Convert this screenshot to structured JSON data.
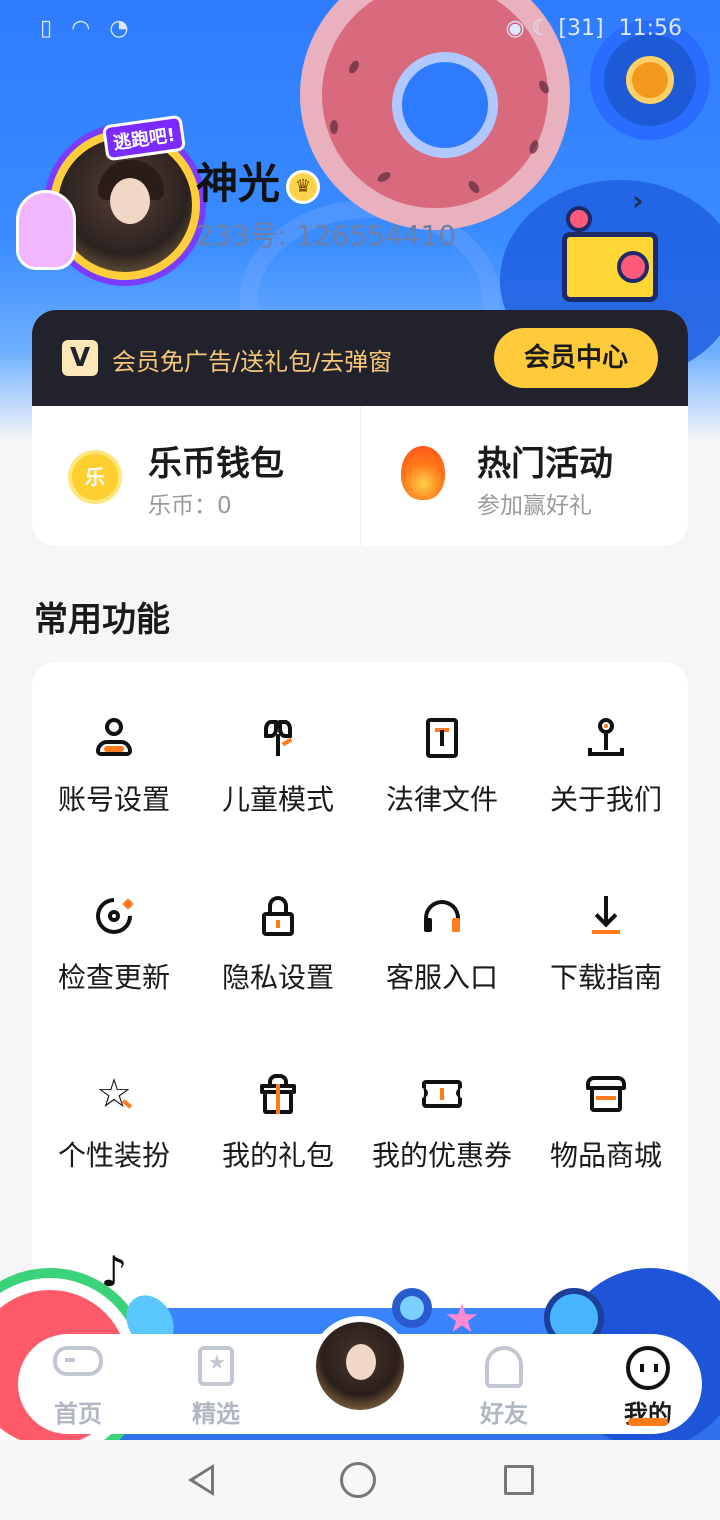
{
  "status_bar": {
    "left_icons": [
      "sim-alert-icon",
      "wifi-icon",
      "data-icon"
    ],
    "battery": "31",
    "time": "11:56"
  },
  "profile": {
    "username": "神光",
    "user_id": "233号: 126554410",
    "avatar_badge": "逃跑吧!"
  },
  "vip": {
    "logo": "V",
    "promo_text": "会员免广告/送礼包/去弹窗",
    "center_button": "会员中心"
  },
  "wallet": {
    "title": "乐币钱包",
    "balance": "乐币：0",
    "coin_glyph": "乐"
  },
  "events": {
    "title": "热门活动",
    "subtitle": "参加赢好礼"
  },
  "functions": {
    "section_title": "常用功能",
    "items": [
      {
        "label": "账号设置",
        "icon": "user-icon"
      },
      {
        "label": "儿童模式",
        "icon": "sprout-icon"
      },
      {
        "label": "法律文件",
        "icon": "document-icon"
      },
      {
        "label": "关于我们",
        "icon": "pin-icon"
      },
      {
        "label": "检查更新",
        "icon": "refresh-icon"
      },
      {
        "label": "隐私设置",
        "icon": "lock-icon"
      },
      {
        "label": "客服入口",
        "icon": "headset-icon"
      },
      {
        "label": "下载指南",
        "icon": "download-icon"
      },
      {
        "label": "个性装扮",
        "icon": "star-icon"
      },
      {
        "label": "我的礼包",
        "icon": "gift-icon"
      },
      {
        "label": "我的优惠券",
        "icon": "ticket-icon"
      },
      {
        "label": "物品商城",
        "icon": "shop-icon"
      },
      {
        "label": "",
        "icon": "tiktok-icon"
      }
    ]
  },
  "tab_bar": {
    "tabs": [
      {
        "label": "首页",
        "icon": "gamepad-icon",
        "active": false
      },
      {
        "label": "精选",
        "icon": "featured-icon",
        "active": false
      },
      {
        "label": "",
        "icon": "avatar-icon",
        "active": false
      },
      {
        "label": "好友",
        "icon": "ghost-icon",
        "active": false
      },
      {
        "label": "我的",
        "icon": "face-icon",
        "active": true
      }
    ]
  },
  "colors": {
    "primary_blue": "#2f7bff",
    "vip_gold": "#ffcb3a",
    "accent_orange": "#ff7a1a",
    "vip_bar": "#22222c"
  }
}
